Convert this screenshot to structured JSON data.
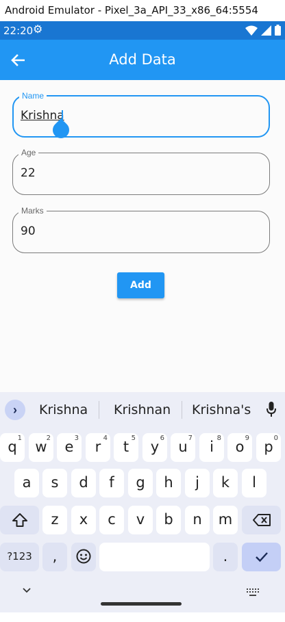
{
  "window": {
    "title": "Android Emulator - Pixel_3a_API_33_x86_64:5554"
  },
  "status_bar": {
    "time": "22:20",
    "settings_icon": "gear-icon",
    "icons": [
      "wifi-icon",
      "signal-icon",
      "battery-icon"
    ]
  },
  "app_bar": {
    "title": "Add Data",
    "back_icon": "arrow-back-icon",
    "color": "#2196f3"
  },
  "form": {
    "name": {
      "label": "Name",
      "value": "Krishna"
    },
    "age": {
      "label": "Age",
      "value": "22"
    },
    "marks": {
      "label": "Marks",
      "value": "90"
    },
    "add_button": "Add"
  },
  "keyboard": {
    "suggestions": [
      "Krishna",
      "Krishnan",
      "Krishna's"
    ],
    "row1": [
      {
        "key": "q",
        "hint": "1"
      },
      {
        "key": "w",
        "hint": "2"
      },
      {
        "key": "e",
        "hint": "3"
      },
      {
        "key": "r",
        "hint": "4"
      },
      {
        "key": "t",
        "hint": "5"
      },
      {
        "key": "y",
        "hint": "6"
      },
      {
        "key": "u",
        "hint": "7"
      },
      {
        "key": "i",
        "hint": "8"
      },
      {
        "key": "o",
        "hint": "9"
      },
      {
        "key": "p",
        "hint": "0"
      }
    ],
    "row2": [
      "a",
      "s",
      "d",
      "f",
      "g",
      "h",
      "j",
      "k",
      "l"
    ],
    "row3": [
      "z",
      "x",
      "c",
      "v",
      "b",
      "n",
      "m"
    ],
    "symbols_key": "?123",
    "comma_key": ",",
    "period_key": ".",
    "icons": [
      "shift-icon",
      "backspace-icon",
      "emoji-icon",
      "check-icon",
      "mic-icon",
      "chevron-right-icon",
      "chevron-down-icon",
      "keyboard-switch-icon"
    ]
  },
  "colors": {
    "primary": "#2196f3",
    "status_bar": "#1976d2",
    "keyboard_bg": "#eceef7",
    "action_key": "#c4cff6"
  }
}
